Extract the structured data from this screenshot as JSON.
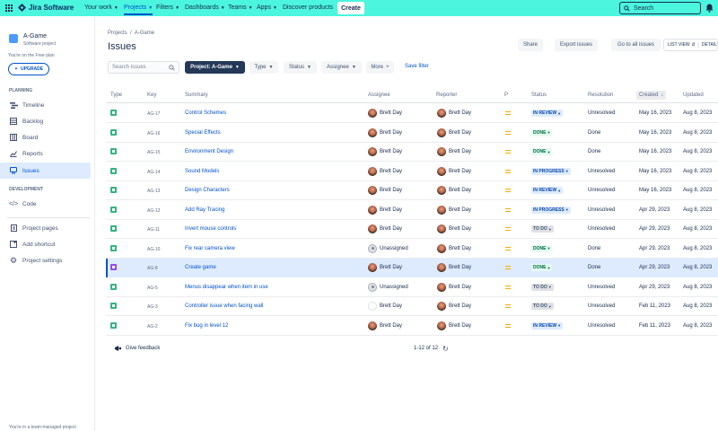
{
  "nav": {
    "product": "Jira Software",
    "items": [
      {
        "label": "Your work",
        "chevron": true
      },
      {
        "label": "Projects",
        "chevron": true
      },
      {
        "label": "Filters",
        "chevron": true
      },
      {
        "label": "Dashboards",
        "chevron": true
      },
      {
        "label": "Teams",
        "chevron": true
      },
      {
        "label": "Apps",
        "chevron": true
      },
      {
        "label": "Discover products",
        "chevron": false
      }
    ],
    "create_label": "Create",
    "search_placeholder": "Search",
    "accent": "#4bf5de"
  },
  "sidebar": {
    "project_name": "A-Game",
    "project_type": "Software project",
    "free_plan": "You're on the Free plan",
    "upgrade_label": "UPGRADE",
    "planning_head": "PLANNING",
    "planning_items": [
      {
        "label": "Timeline",
        "icon": "timeline-icon"
      },
      {
        "label": "Backlog",
        "icon": "backlog-icon"
      },
      {
        "label": "Board",
        "icon": "board-icon"
      },
      {
        "label": "Reports",
        "icon": "reports-icon"
      },
      {
        "label": "Issues",
        "icon": "issues-icon",
        "active": true
      }
    ],
    "development_head": "DEVELOPMENT",
    "development_items": [
      {
        "label": "Code",
        "icon": "code-icon"
      }
    ],
    "bottom_items": [
      {
        "label": "Project pages",
        "icon": "pages-icon"
      },
      {
        "label": "Add shortcut",
        "icon": "shortcut-icon"
      },
      {
        "label": "Project settings",
        "icon": "gear-icon"
      }
    ],
    "footer": "You're in a team-managed project"
  },
  "main": {
    "breadcrumb": [
      "Projects",
      "A-Game"
    ],
    "title": "Issues",
    "actions": [
      "Share",
      "Export issues",
      "Go to all issues"
    ],
    "list_view": "LIST VIEW",
    "detail_view": "DETAIL",
    "filters": {
      "search_placeholder": "Search issues",
      "project": "Project: A-Game",
      "type": "Type",
      "status": "Status",
      "assignee": "Assignee",
      "more": "More",
      "save": "Save filter"
    },
    "columns": [
      "Type",
      "Key",
      "Summary",
      "Assignee",
      "Reporter",
      "P",
      "Status",
      "Resolution",
      "Created",
      "Updated"
    ],
    "rows": [
      {
        "key": "AG-17",
        "summary": "Control Schemes",
        "assignee": "Brett Day",
        "reporter": "Brett Day",
        "status": "IN REVIEW",
        "resolution": "Unresolved",
        "created": "May 16, 2023",
        "updated": "Aug 8, 2023"
      },
      {
        "key": "AG-16",
        "summary": "Special Effects",
        "assignee": "Brett Day",
        "reporter": "Brett Day",
        "status": "DONE",
        "resolution": "Done",
        "created": "May 16, 2023",
        "updated": "Aug 8, 2023"
      },
      {
        "key": "AG-15",
        "summary": "Environment Design",
        "assignee": "Brett Day",
        "reporter": "Brett Day",
        "status": "DONE",
        "resolution": "Done",
        "created": "May 16, 2023",
        "updated": "Aug 8, 2023"
      },
      {
        "key": "AG-14",
        "summary": "Sound Models",
        "assignee": "Brett Day",
        "reporter": "Brett Day",
        "status": "IN PROGRESS",
        "resolution": "Unresolved",
        "created": "May 16, 2023",
        "updated": "Aug 8, 2023"
      },
      {
        "key": "AG-13",
        "summary": "Design Characters",
        "assignee": "Brett Day",
        "reporter": "Brett Day",
        "status": "IN REVIEW",
        "resolution": "Unresolved",
        "created": "May 16, 2023",
        "updated": "Aug 8, 2023"
      },
      {
        "key": "AG-12",
        "summary": "Add Ray Tracing",
        "assignee": "Brett Day",
        "reporter": "Brett Day",
        "status": "IN PROGRESS",
        "resolution": "Unresolved",
        "created": "Apr 29, 2023",
        "updated": "Aug 8, 2023"
      },
      {
        "key": "AG-11",
        "summary": "Invert mouse controls",
        "assignee": "Brett Day",
        "reporter": "Brett Day",
        "status": "TO DO",
        "resolution": "Unresolved",
        "created": "Apr 29, 2023",
        "updated": "Aug 8, 2023"
      },
      {
        "key": "AG-10",
        "summary": "Fix rear camera view",
        "assignee": "Unassigned",
        "reporter": "Brett Day",
        "status": "DONE",
        "resolution": "Done",
        "created": "Apr 29, 2023",
        "updated": "Aug 8, 2023"
      },
      {
        "key": "AG-8",
        "summary": "Create game",
        "assignee": "Brett Day",
        "reporter": "Brett Day",
        "status": "DONE",
        "resolution": "Done",
        "created": "Apr 29, 2023",
        "updated": "Aug 8, 2023",
        "selected": true,
        "epic": true
      },
      {
        "key": "AG-5",
        "summary": "Menus disappear when item in use",
        "assignee": "Unassigned",
        "reporter": "Brett Day",
        "status": "TO DO",
        "resolution": "Unresolved",
        "created": "Apr 29, 2023",
        "updated": "Aug 8, 2023"
      },
      {
        "key": "AG-3",
        "summary": "Controller issue when facing wall",
        "assignee": "Brett Day",
        "reporter": "Brett Day",
        "status": "TO DO",
        "resolution": "Unresolved",
        "created": "Feb 11, 2023",
        "updated": "Aug 8, 2023",
        "assignee_blank": true
      },
      {
        "key": "AG-2",
        "summary": "Fix bug in level 12",
        "assignee": "Brett Day",
        "reporter": "Brett Day",
        "status": "IN REVIEW",
        "resolution": "Unresolved",
        "created": "Feb 11, 2023",
        "updated": "Aug 8, 2023"
      }
    ],
    "feedback": "Give feedback",
    "pager": "1-12 of 12"
  }
}
